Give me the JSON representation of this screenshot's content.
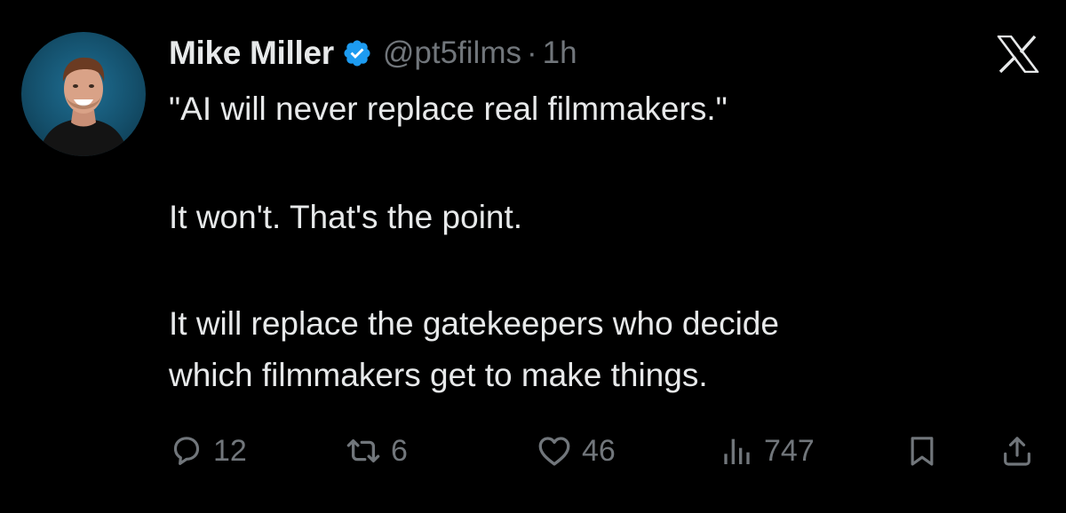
{
  "tweet": {
    "author": {
      "name": "Mike Miller",
      "handle": "@pt5films",
      "separator": "·",
      "time": "1h",
      "verified": true
    },
    "body": {
      "line1": "\"AI will never replace real filmmakers.\"",
      "line2": "It won't. That's the point.",
      "line3": "It will replace the gatekeepers who decide",
      "line4": "which filmmakers get to make things."
    },
    "actions": {
      "replies": "12",
      "reposts": "6",
      "likes": "46",
      "views": "747"
    }
  },
  "icons": {
    "platform": "x-logo-icon",
    "verified": "verified-badge-icon",
    "reply": "reply-icon",
    "repost": "repost-icon",
    "like": "heart-icon",
    "views": "views-icon",
    "bookmark": "bookmark-icon",
    "share": "share-icon"
  },
  "colors": {
    "background": "#000000",
    "text_primary": "#e7e9ea",
    "text_secondary": "#71767b",
    "verified_blue": "#1d9bf0"
  }
}
